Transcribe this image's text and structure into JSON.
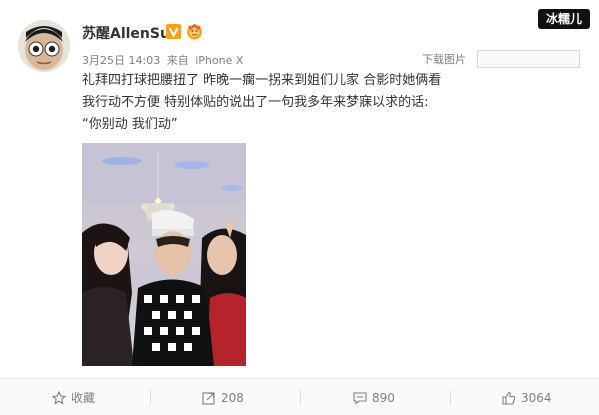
{
  "user": {
    "name": "苏醒AllenSu",
    "verified_badge": "V",
    "accent": "#f7a41d"
  },
  "meta": {
    "date": "3月25日 14:03",
    "source_prefix": "来自",
    "source": "iPhone X"
  },
  "watermark": "冰糯儿",
  "download_label": "下载图片",
  "post": {
    "lines": [
      "礼拜四打球把腰扭了 昨晚一瘸一拐来到姐们儿家 合影时她俩看",
      "我行动不方便 特别体贴的说出了一句我多年来梦寐以求的话:",
      "“你别动 我们动”"
    ]
  },
  "footer": {
    "favorite_label": "收藏",
    "repost_count": "208",
    "comment_count": "890",
    "like_count": "3064"
  },
  "icons": [
    "star-icon",
    "repost-icon",
    "comment-icon",
    "like-icon"
  ]
}
